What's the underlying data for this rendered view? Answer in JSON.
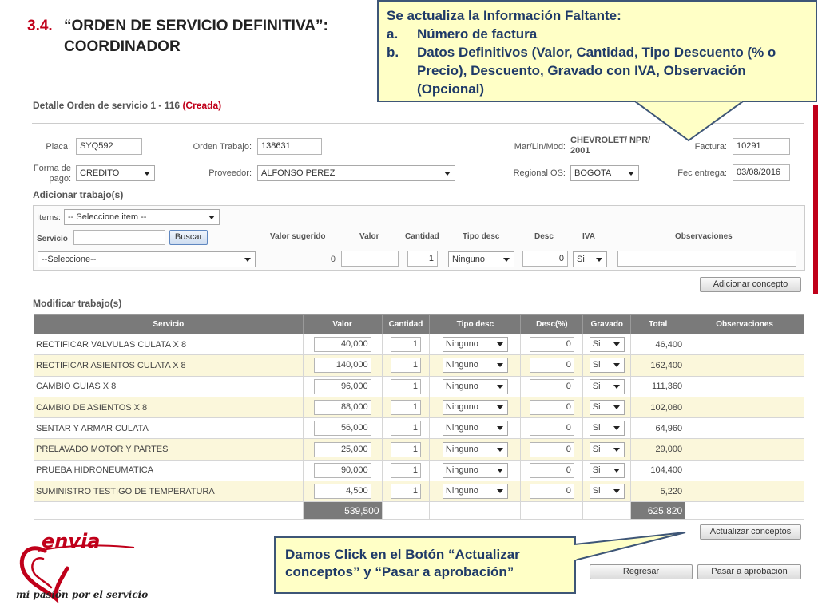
{
  "slide": {
    "number": "3.4.",
    "title_line1": "“ORDEN DE SERVICIO DEFINITIVA”:",
    "title_line2": "COORDINADOR"
  },
  "callout_top": {
    "heading": "Se actualiza la Información Faltante:",
    "items": [
      {
        "marker": "a.",
        "text": "Número de factura"
      },
      {
        "marker": "b.",
        "text": "Datos Definitivos (Valor, Cantidad, Tipo Descuento (% o Precio), Descuento, Gravado con IVA, Observación (Opcional)"
      }
    ]
  },
  "callout_bottom": {
    "text": "Damos Click en el Botón “Actualizar conceptos” y “Pasar a aprobación”"
  },
  "panel": {
    "title": "Detalle Orden de servicio 1 - 116",
    "status": "(Creada)"
  },
  "form": {
    "placa_label": "Placa:",
    "placa_value": "SYQ592",
    "orden_label": "Orden Trabajo:",
    "orden_value": "138631",
    "marlin_label": "Mar/Lin/Mod:",
    "marlin_value_1": "CHEVROLET/ NPR/",
    "marlin_value_2": "2001",
    "factura_label": "Factura:",
    "factura_value": "10291",
    "formapago_label_1": "Forma de",
    "formapago_label_2": "pago:",
    "formapago_value": "CREDITO",
    "proveedor_label": "Proveedor:",
    "proveedor_value": "ALFONSO PEREZ",
    "regional_label": "Regional OS:",
    "regional_value": "BOGOTA",
    "fecentrega_label": "Fec entrega:",
    "fecentrega_value": "03/08/2016"
  },
  "add_work": {
    "title": "Adicionar trabajo(s)",
    "items_label": "Items:",
    "items_value": "-- Seleccione item --",
    "servicio_label": "Servicio",
    "buscar_label": "Buscar",
    "headers": [
      "Valor sugerido",
      "Valor",
      "Cantidad",
      "Tipo desc",
      "Desc",
      "IVA",
      "Observaciones"
    ],
    "servicio_select": "--Seleccione--",
    "valor_sugerido": "0",
    "cantidad": "1",
    "tipo_desc": "Ninguno",
    "desc": "0",
    "iva": "Si",
    "add_button": "Adicionar concepto"
  },
  "modify_work": {
    "title": "Modificar trabajo(s)",
    "columns": [
      "Servicio",
      "Valor",
      "Cantidad",
      "Tipo desc",
      "Desc(%)",
      "Gravado",
      "Total",
      "Observaciones"
    ],
    "rows": [
      {
        "servicio": "RECTIFICAR VALVULAS CULATA X 8",
        "valor": "40,000",
        "cantidad": "1",
        "tipo_desc": "Ninguno",
        "desc": "0",
        "gravado": "Si",
        "total": "46,400"
      },
      {
        "servicio": "RECTIFICAR ASIENTOS CULATA X 8",
        "valor": "140,000",
        "cantidad": "1",
        "tipo_desc": "Ninguno",
        "desc": "0",
        "gravado": "Si",
        "total": "162,400"
      },
      {
        "servicio": "CAMBIO GUIAS X 8",
        "valor": "96,000",
        "cantidad": "1",
        "tipo_desc": "Ninguno",
        "desc": "0",
        "gravado": "Si",
        "total": "111,360"
      },
      {
        "servicio": "CAMBIO DE ASIENTOS X 8",
        "valor": "88,000",
        "cantidad": "1",
        "tipo_desc": "Ninguno",
        "desc": "0",
        "gravado": "Si",
        "total": "102,080"
      },
      {
        "servicio": "SENTAR Y ARMAR CULATA",
        "valor": "56,000",
        "cantidad": "1",
        "tipo_desc": "Ninguno",
        "desc": "0",
        "gravado": "Si",
        "total": "64,960"
      },
      {
        "servicio": "PRELAVADO MOTOR Y PARTES",
        "valor": "25,000",
        "cantidad": "1",
        "tipo_desc": "Ninguno",
        "desc": "0",
        "gravado": "Si",
        "total": "29,000"
      },
      {
        "servicio": "PRUEBA HIDRONEUMATICA",
        "valor": "90,000",
        "cantidad": "1",
        "tipo_desc": "Ninguno",
        "desc": "0",
        "gravado": "Si",
        "total": "104,400"
      },
      {
        "servicio": "SUMINISTRO TESTIGO DE TEMPERATURA",
        "valor": "4,500",
        "cantidad": "1",
        "tipo_desc": "Ninguno",
        "desc": "0",
        "gravado": "Si",
        "total": "5,220"
      }
    ],
    "sum_valor": "539,500",
    "sum_total": "625,820"
  },
  "buttons": {
    "actualizar": "Actualizar conceptos",
    "regresar": "Regresar",
    "aprobacion": "Pasar a aprobación"
  },
  "logo": {
    "brand": "envia",
    "tagline": "mi pasión por el servicio"
  },
  "colors": {
    "accent_red": "#c0001a",
    "callout_bg": "#ffffc6",
    "callout_text": "#1f3a68",
    "table_header": "#7a7a7a",
    "row_alt": "#fbf7db"
  }
}
